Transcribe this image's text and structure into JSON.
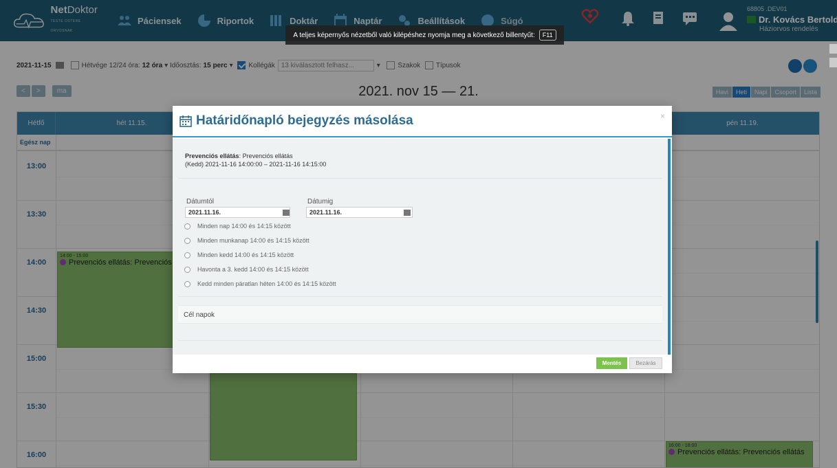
{
  "nav": {
    "logo_name_bold": "Net",
    "logo_name_rest": "Doktor",
    "logo_tagline": "TESTE OSTERE ORVOSNAK",
    "items": [
      "Páciensek",
      "Riportok",
      "Doktár",
      "Naptár",
      "Beállítások",
      "Súgó"
    ]
  },
  "user": {
    "code": "68805 .DEV01",
    "name": "Dr. Kovács Bertold",
    "role": "Háziorvos rendelés"
  },
  "fullscreen_tip": {
    "text": "A teljes képernyős nézetből való kilépéshez nyomja meg a következő billentyűt:",
    "key": "F11"
  },
  "toolbar": {
    "date": "2021-11-15",
    "weekend_label": "Hétvége 12/24 óra:",
    "weekend_value": "12 óra",
    "time_split_label": "Időosztás:",
    "time_split_value": "15 perc",
    "colleagues_label": "Kollégák",
    "colleagues_value": "13 kiválasztott felhasz...",
    "specialties_label": "Szakok",
    "types_label": "Típusok"
  },
  "calendar": {
    "prev": "<",
    "next": ">",
    "today": "ma",
    "range_title": "2021. nov 15 — 21.",
    "views": [
      "Havi",
      "Heti",
      "Napi",
      "Csoport",
      "Lista"
    ],
    "active_view": "Heti",
    "headers": [
      "Hétfő",
      "hét 11.15.",
      "",
      "",
      "",
      "pén 11.19."
    ],
    "allday_label": "Egész nap",
    "times": [
      "13:00",
      "13:30",
      "14:00",
      "14:30",
      "15:00",
      "15:30",
      "16:00"
    ],
    "events": [
      {
        "time": "14:00 - 15:00",
        "name": "Prevenciós ellátás: Prevenciós ellátás"
      },
      {
        "time": "",
        "name": ""
      },
      {
        "time": "16:00 - 18:00",
        "name": "Prevenciós ellátás: Prevenciós ellátás"
      }
    ]
  },
  "modal": {
    "title": "Határidőnapló bejegyzés másolása",
    "close": "×",
    "summary_bold": "Prevenciós ellátás",
    "summary_rest": ": Prevenciós ellátás",
    "summary_time": "(Kedd) 2021-11-16 14:00:00 – 2021-11-16 14:15:00",
    "date_from_label": "Dátumtól",
    "date_from_value": "2021.11.16.",
    "date_to_label": "Dátumig",
    "date_to_value": "2021.11.16.",
    "options": [
      "Minden nap 14:00 és 14:15 között",
      "Minden munkanap 14:00 és 14:15 között",
      "Minden kedd 14:00 és 14:15 között",
      "Havonta a 3. kedd 14:00 és 14:15 között",
      "Kedd minden páratlan héten 14:00 és 14:15 között"
    ],
    "target_days_label": "Cél napok",
    "save_button": "Mentés",
    "close_button": "Bezárás"
  },
  "colors": {
    "nav_bg": "#1d5a73",
    "header_blue": "#3f8bb4",
    "accent": "#2f9bd0",
    "event_green": "#8cc26e",
    "save_green": "#7dc24c",
    "event_dot": "#a64ac9"
  }
}
